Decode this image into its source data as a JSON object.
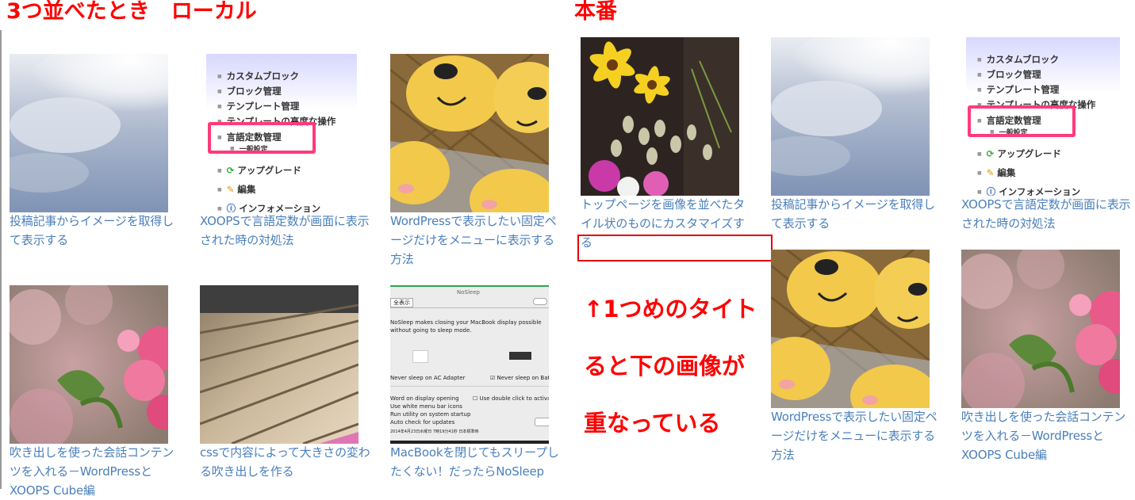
{
  "labels": {
    "left_heading": "3つ並べたとき　ローカル",
    "right_heading": "本番",
    "note": "↑1つめのタイトルが2行になると下の画像が重なっている"
  },
  "note_lines": [
    "↑1つめのタイト",
    "ると下の画像が",
    "重なっている"
  ],
  "colors": {
    "link": "#4a7fbb",
    "annotation": "#ff0000",
    "highlight_box": "#e60000"
  },
  "menu_shot": {
    "items": [
      "カスタムブロック",
      "ブロック管理",
      "テンプレート管理",
      "テンプレートの高度な操作",
      "言語定数管理",
      "一般設定",
      "アップグレード",
      "編集",
      "インフォメーション"
    ]
  },
  "nosleep_shot": {
    "window_title": "NoSleep",
    "toolbar_button": "全表示",
    "desc": "NoSleep makes closing your MacBook display possible without going to sleep mode.",
    "ac_label": "Never sleep on AC Adapter",
    "battery_label": "Never sleep on Battery",
    "opt1": "Word on display opening",
    "opt2": "Use white menu bar icons",
    "opt3": "Run utility on system startup",
    "opt4": "Auto check for updates",
    "dbl": "Use double click to activate",
    "footer": "2014年4月23日水曜日 7時19分41秒 日本標準時"
  },
  "local": {
    "cards": [
      {
        "title": "投稿記事からイメージを取得して表示する",
        "image": "sky-photo"
      },
      {
        "title": "XOOPSで言語定数が画面に表示された時の対処法",
        "image": "admin-menu-screenshot"
      },
      {
        "title": "WordPressで表示したい固定ページだけをメニューに表示する方法",
        "image": "bear-bread-photo"
      },
      {
        "title": "吹き出しを使った会話コンテンツを入れる－WordPressとXOOPS Cube編",
        "image": "pink-flowers-photo"
      },
      {
        "title": "cssで内容によって大きさの変わる吹き出しを作る",
        "image": "wood-deck-photo"
      },
      {
        "title": "MacBookを閉じてもスリープしたくない！だったらNoSleep",
        "image": "nosleep-screenshot"
      }
    ]
  },
  "production": {
    "cards": [
      {
        "title": "トップページを画像を並べたタイル状のものにカスタマイズする",
        "image": "flower-bouquet-photo"
      },
      {
        "title": "投稿記事からイメージを取得して表示する",
        "image": "sky-photo"
      },
      {
        "title": "XOOPSで言語定数が画面に表示された時の対処法",
        "image": "admin-menu-screenshot"
      },
      {
        "title": "WordPressで表示したい固定ページだけをメニューに表示する方法",
        "image": "bear-bread-photo"
      },
      {
        "title": "吹き出しを使った会話コンテンツを入れる－WordPressとXOOPS Cube編",
        "image": "pink-flowers-photo"
      }
    ]
  }
}
